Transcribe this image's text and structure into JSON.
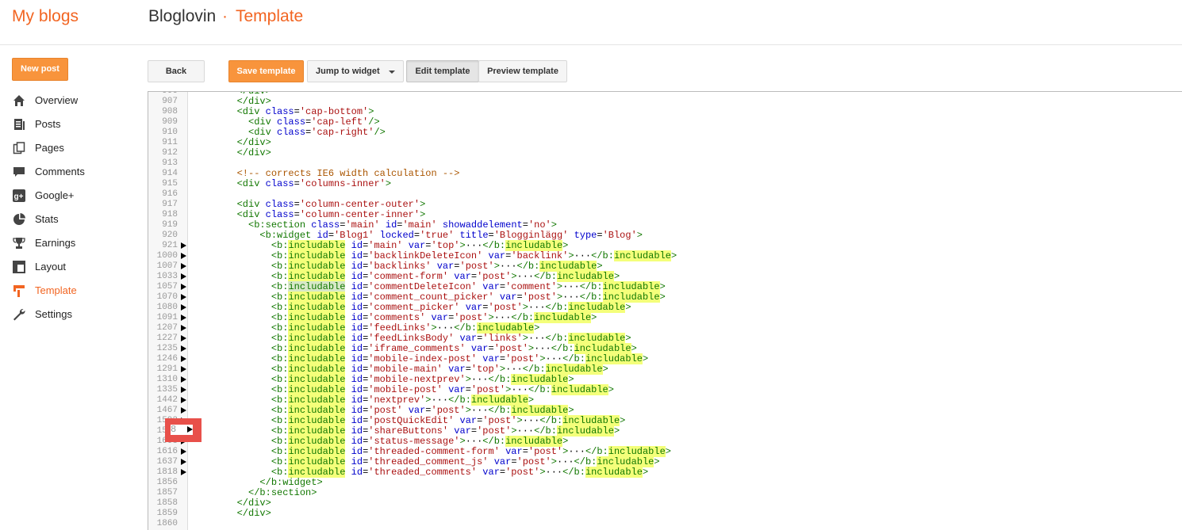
{
  "header": {
    "brand": "My blogs",
    "blog_name": "Bloglovin",
    "separator": "·",
    "page_name": "Template"
  },
  "toolbar": {
    "new_post": "New post",
    "back": "Back",
    "save_template": "Save template",
    "jump_to_widget": "Jump to widget",
    "edit_template": "Edit template",
    "preview_template": "Preview template"
  },
  "colors": {
    "accent": "#f26522",
    "button_orange": "#f8943c",
    "highlight": "#f4ff7a",
    "marker": "#e8504a"
  },
  "sidebar": {
    "items": [
      {
        "label": "Overview",
        "icon": "home-icon",
        "active": false
      },
      {
        "label": "Posts",
        "icon": "posts-icon",
        "active": false
      },
      {
        "label": "Pages",
        "icon": "pages-icon",
        "active": false
      },
      {
        "label": "Comments",
        "icon": "comments-icon",
        "active": false
      },
      {
        "label": "Google+",
        "icon": "google-plus-icon",
        "active": false
      },
      {
        "label": "Stats",
        "icon": "stats-icon",
        "active": false
      },
      {
        "label": "Earnings",
        "icon": "trophy-icon",
        "active": false
      },
      {
        "label": "Layout",
        "icon": "layout-icon",
        "active": false
      },
      {
        "label": "Template",
        "icon": "template-icon",
        "active": true
      },
      {
        "label": "Settings",
        "icon": "wrench-icon",
        "active": false
      }
    ]
  },
  "editor": {
    "marker_text": "8",
    "lines": [
      {
        "n": "906",
        "fold": false,
        "code": "        </div>"
      },
      {
        "n": "907",
        "fold": false,
        "code": "        </div>"
      },
      {
        "n": "908",
        "fold": false,
        "code": "        <div class='cap-bottom'>"
      },
      {
        "n": "909",
        "fold": false,
        "code": "          <div class='cap-left'/>"
      },
      {
        "n": "910",
        "fold": false,
        "code": "          <div class='cap-right'/>"
      },
      {
        "n": "911",
        "fold": false,
        "code": "        </div>"
      },
      {
        "n": "912",
        "fold": false,
        "code": "        </div>"
      },
      {
        "n": "913",
        "fold": false,
        "code": ""
      },
      {
        "n": "914",
        "fold": false,
        "code": "        <!-- corrects IE6 width calculation -->"
      },
      {
        "n": "915",
        "fold": false,
        "code": "        <div class='columns-inner'>"
      },
      {
        "n": "916",
        "fold": false,
        "code": ""
      },
      {
        "n": "917",
        "fold": false,
        "code": "        <div class='column-center-outer'>"
      },
      {
        "n": "918",
        "fold": false,
        "code": "        <div class='column-center-inner'>"
      },
      {
        "n": "919",
        "fold": false,
        "code": "          <b:section class='main' id='main' showaddelement='no'>"
      },
      {
        "n": "920",
        "fold": false,
        "code": "            <b:widget id='Blog1' locked='true' title='Blogginlägg' type='Blog'>"
      },
      {
        "n": "921",
        "fold": true,
        "code": "              <b:includable id='main' var='top'>···</b:includable>"
      },
      {
        "n": "1000",
        "fold": true,
        "code": "              <b:includable id='backlinkDeleteIcon' var='backlink'>···</b:includable>"
      },
      {
        "n": "1007",
        "fold": true,
        "code": "              <b:includable id='backlinks' var='post'>···</b:includable>"
      },
      {
        "n": "1033",
        "fold": true,
        "code": "              <b:includable id='comment-form' var='post'>···</b:includable>"
      },
      {
        "n": "1057",
        "fold": true,
        "code": "              <b:includable id='commentDeleteIcon' var='comment'>···</b:includable>"
      },
      {
        "n": "1070",
        "fold": true,
        "code": "              <b:includable id='comment_count_picker' var='post'>···</b:includable>"
      },
      {
        "n": "1080",
        "fold": true,
        "code": "              <b:includable id='comment_picker' var='post'>···</b:includable>"
      },
      {
        "n": "1091",
        "fold": true,
        "code": "              <b:includable id='comments' var='post'>···</b:includable>"
      },
      {
        "n": "1207",
        "fold": true,
        "code": "              <b:includable id='feedLinks'>···</b:includable>"
      },
      {
        "n": "1227",
        "fold": true,
        "code": "              <b:includable id='feedLinksBody' var='links'>···</b:includable>"
      },
      {
        "n": "1235",
        "fold": true,
        "code": "              <b:includable id='iframe_comments' var='post'>···</b:includable>"
      },
      {
        "n": "1246",
        "fold": true,
        "code": "              <b:includable id='mobile-index-post' var='post'>···</b:includable>"
      },
      {
        "n": "1291",
        "fold": true,
        "code": "              <b:includable id='mobile-main' var='top'>···</b:includable>"
      },
      {
        "n": "1310",
        "fold": true,
        "code": "              <b:includable id='mobile-nextprev'>···</b:includable>"
      },
      {
        "n": "1335",
        "fold": true,
        "code": "              <b:includable id='mobile-post' var='post'>···</b:includable>"
      },
      {
        "n": "1442",
        "fold": true,
        "code": "              <b:includable id='nextprev'>···</b:includable>"
      },
      {
        "n": "1467",
        "fold": true,
        "code": "              <b:includable id='post' var='post'>···</b:includable>"
      },
      {
        "n": "1592",
        "fold": true,
        "code": "              <b:includable id='postQuickEdit' var='post'>···</b:includable>"
      },
      {
        "n": "1598",
        "fold": true,
        "code": "              <b:includable id='shareButtons' var='post'>···</b:includable>"
      },
      {
        "n": "1608",
        "fold": true,
        "code": "              <b:includable id='status-message'>···</b:includable>"
      },
      {
        "n": "1616",
        "fold": true,
        "code": "              <b:includable id='threaded-comment-form' var='post'>···</b:includable>"
      },
      {
        "n": "1637",
        "fold": true,
        "code": "              <b:includable id='threaded_comment_js' var='post'>···</b:includable>"
      },
      {
        "n": "1818",
        "fold": true,
        "code": "              <b:includable id='threaded_comments' var='post'>···</b:includable>"
      },
      {
        "n": "1856",
        "fold": false,
        "code": "            </b:widget>"
      },
      {
        "n": "1857",
        "fold": false,
        "code": "          </b:section>"
      },
      {
        "n": "1858",
        "fold": false,
        "code": "        </div>"
      },
      {
        "n": "1859",
        "fold": false,
        "code": "        </div>"
      },
      {
        "n": "1860",
        "fold": false,
        "code": ""
      }
    ]
  }
}
